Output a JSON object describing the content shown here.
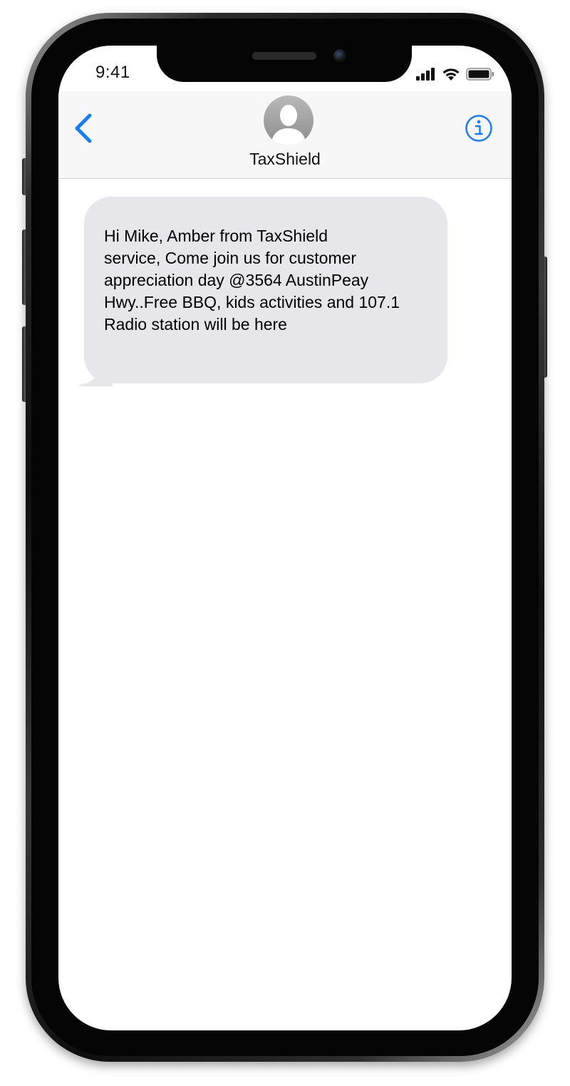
{
  "status_bar": {
    "time": "9:41",
    "signal_icon": "cellular-signal-icon",
    "wifi_icon": "wifi-icon",
    "battery_icon": "battery-icon"
  },
  "header": {
    "back_icon": "chevron-left-icon",
    "avatar_icon": "person-silhouette-icon",
    "contact_name": "TaxShield",
    "info_icon": "info-circle-icon"
  },
  "conversation": {
    "messages": [
      {
        "direction": "incoming",
        "text": "Hi Mike, Amber from TaxShield\nservice, Come join us for customer\nappreciation day @3564 AustinPeay\nHwy..Free BBQ, kids activities and 107.1\nRadio station will be here"
      }
    ]
  },
  "colors": {
    "accent": "#1a7cf2",
    "incoming_bubble": "#e6e6eb",
    "header_bg": "#f7f7f7"
  }
}
